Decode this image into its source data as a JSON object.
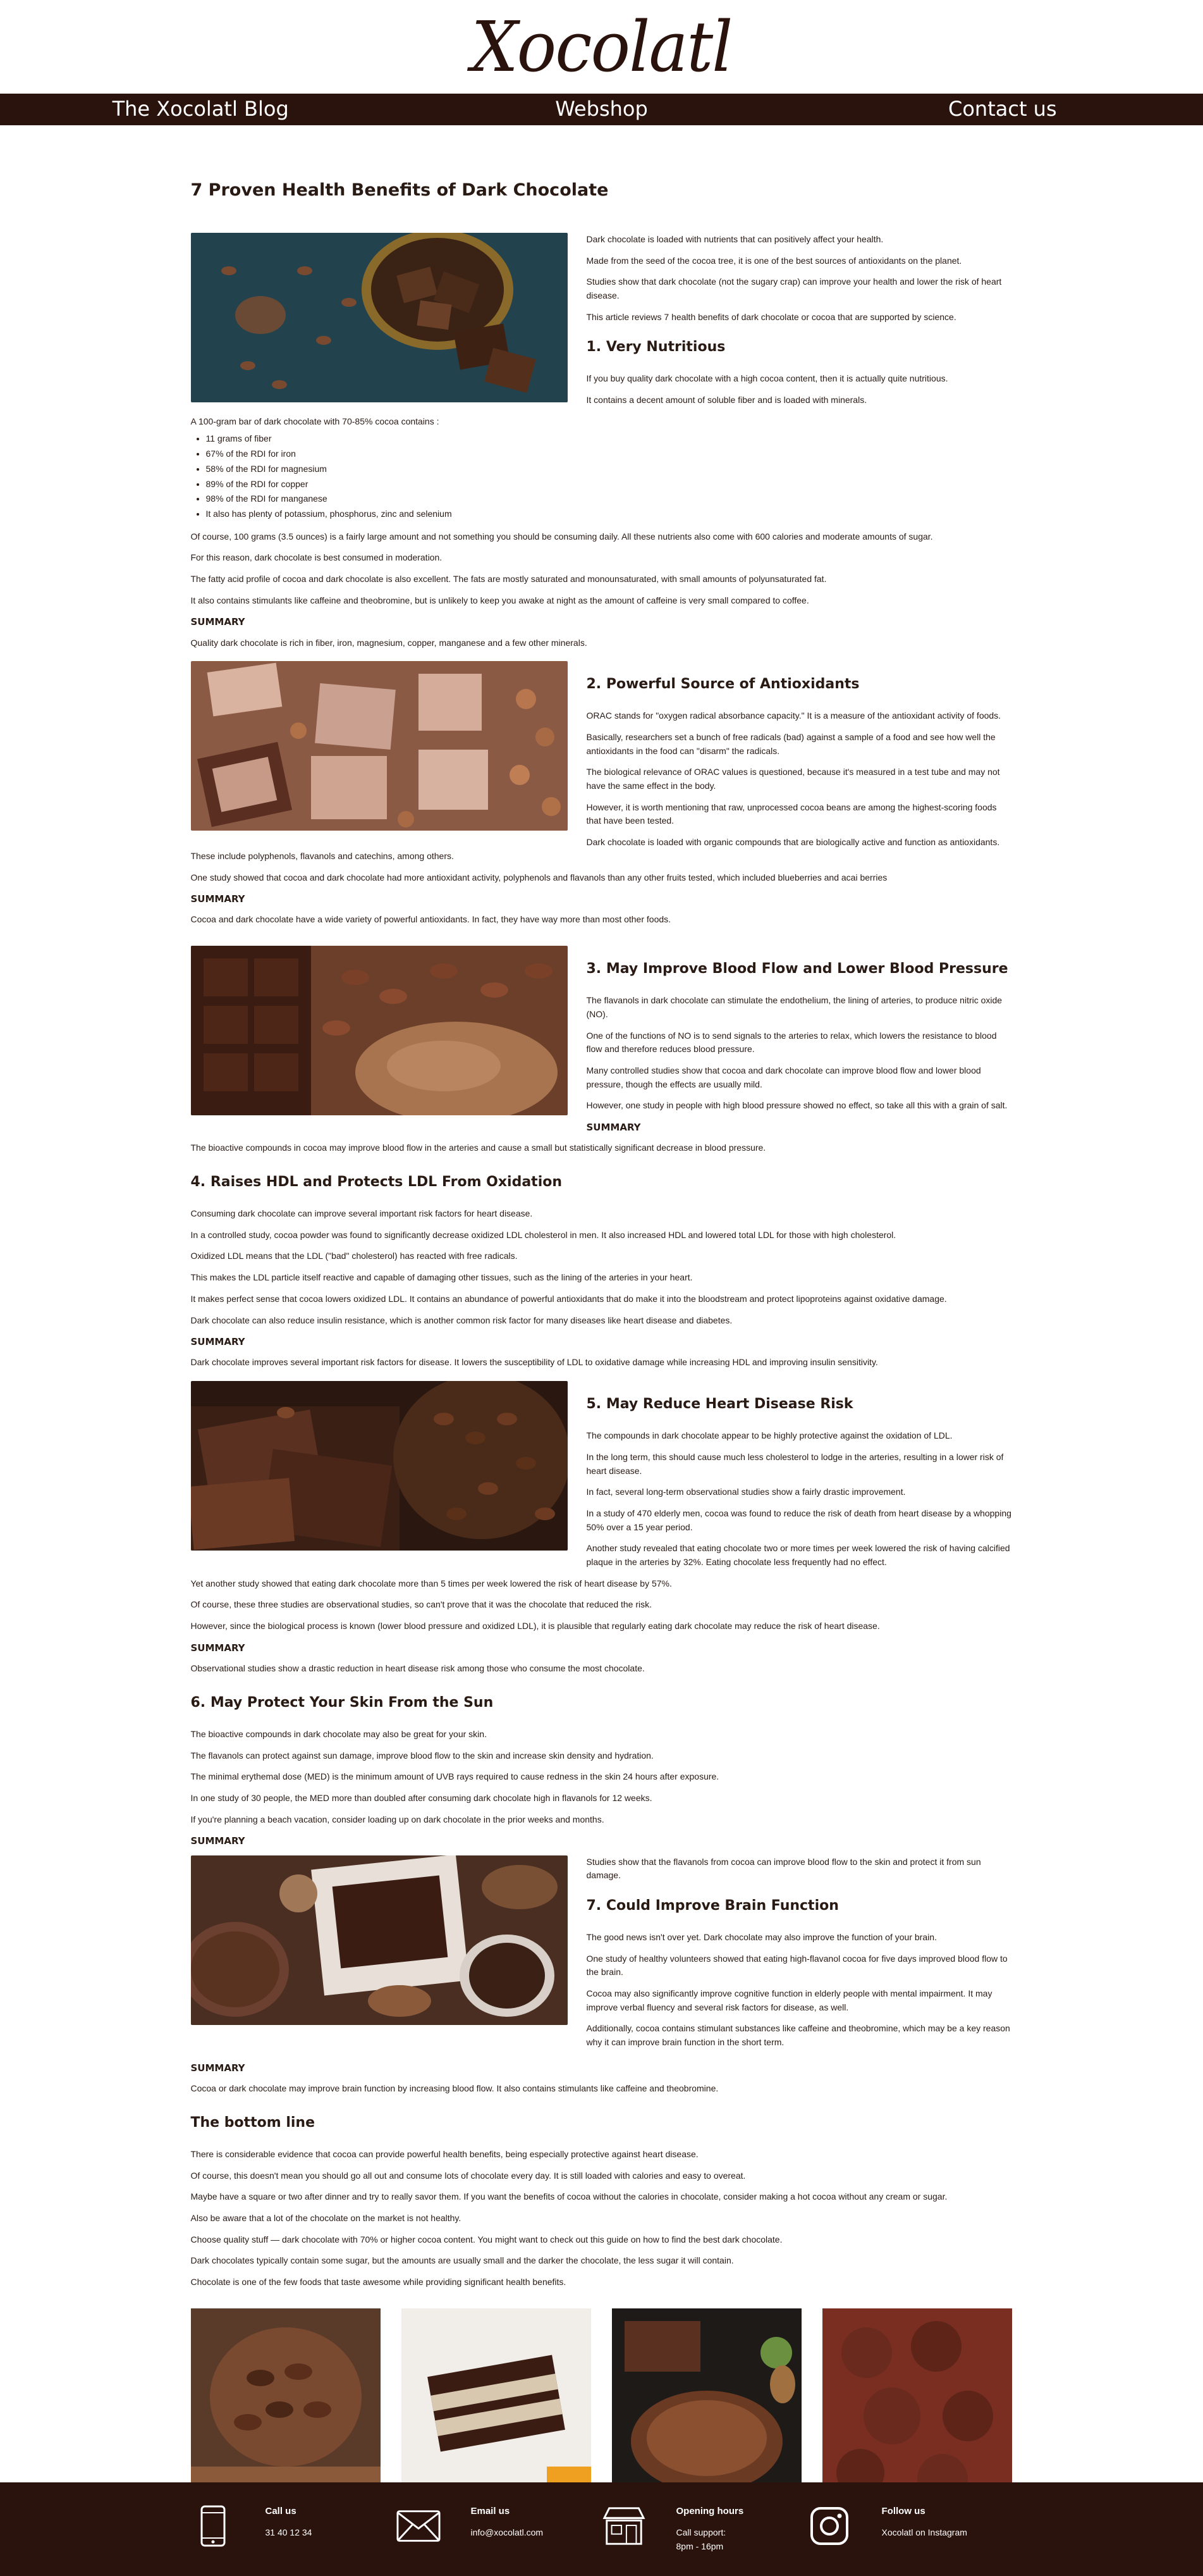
{
  "logo": "Xocolatl",
  "nav": [
    "The Xocolatl Blog",
    "Webshop",
    "Contact us"
  ],
  "title": "7 Proven Health Benefits of Dark Chocolate",
  "intro": [
    "Dark chocolate is loaded with nutrients that can positively affect your health.",
    "Made from the seed of the cocoa tree, it is one of the best sources of antioxidants on the planet.",
    "Studies show that dark chocolate (not the sugary crap) can improve your health and lower the risk of heart disease.",
    "This article reviews 7 health benefits of dark chocolate or cocoa that are supported by science."
  ],
  "s1": {
    "heading": "1. Very Nutritious",
    "p": [
      "If you buy quality dark chocolate with a high cocoa content, then it is actually quite nutritious.",
      "It contains a decent amount of soluble fiber and is loaded with minerals."
    ],
    "list_intro": "A 100-gram bar of dark chocolate with 70-85% cocoa contains :",
    "list": [
      "11 grams of fiber",
      "67% of the RDI for iron",
      "58% of the RDI for magnesium",
      "89% of the RDI for copper",
      "98% of the RDI for manganese",
      "It also has plenty of potassium, phosphorus, zinc and selenium"
    ],
    "p2": [
      "Of course, 100 grams (3.5 ounces) is a fairly large amount and not something you should be consuming daily. All these nutrients also come with 600 calories and moderate amounts of sugar.",
      "For this reason, dark chocolate is best consumed in moderation.",
      "The fatty acid profile of cocoa and dark chocolate is also excellent. The fats are mostly saturated and monounsaturated, with small amounts of polyunsaturated fat.",
      "It also contains stimulants like caffeine and theobromine, but is unlikely to keep you awake at night as the amount of caffeine is very small compared to coffee."
    ],
    "summary_label": "SUMMARY",
    "summary": "Quality dark chocolate is rich in fiber, iron, magnesium, copper, manganese and a few other minerals."
  },
  "s2": {
    "heading": "2. Powerful Source of Antioxidants",
    "p": [
      "ORAC stands for \"oxygen radical absorbance capacity.\" It is a measure of the antioxidant activity of foods.",
      "Basically, researchers set a bunch of free radicals (bad) against a sample of a food and see how well the antioxidants in the food can \"disarm\" the radicals.",
      "The biological relevance of ORAC values is questioned, because it's measured in a test tube and may not have the same effect in the body.",
      "However, it is worth mentioning that raw, unprocessed cocoa beans are among the highest-scoring foods that have been tested.",
      "Dark chocolate is loaded with organic compounds that are biologically active and function as antioxidants. These include polyphenols, flavanols and catechins, among others.",
      "One study showed that cocoa and dark chocolate had more antioxidant activity, polyphenols and flavanols than any other fruits tested, which included blueberries and acai berries"
    ],
    "summary_label": "SUMMARY",
    "summary": "Cocoa and dark chocolate have a wide variety of powerful antioxidants. In fact, they have way more than most other foods."
  },
  "s3": {
    "heading": "3. May Improve Blood Flow and Lower Blood Pressure",
    "p": [
      "The flavanols in dark chocolate can stimulate the endothelium, the lining of arteries, to produce nitric oxide (NO).",
      "One of the functions of NO is to send signals to the arteries to relax, which lowers the resistance to blood flow and therefore reduces blood pressure.",
      "Many controlled studies show that cocoa and dark chocolate can improve blood flow and lower blood pressure, though the effects are usually mild.",
      "However, one study in people with high blood pressure showed no effect, so take all this with a grain of salt."
    ],
    "summary_label": "SUMMARY",
    "summary": "The bioactive compounds in cocoa may improve blood flow in the arteries and cause a small but statistically significant decrease in blood pressure."
  },
  "s4": {
    "heading": "4. Raises HDL and Protects LDL From Oxidation",
    "p": [
      "Consuming dark chocolate can improve several important risk factors for heart disease.",
      "In a controlled study, cocoa powder was found to significantly decrease oxidized LDL cholesterol in men. It also increased HDL and lowered total LDL for those with high cholesterol.",
      "Oxidized LDL means that the LDL (\"bad\" cholesterol) has reacted with free radicals.",
      "This makes the LDL particle itself reactive and capable of damaging other tissues, such as the lining of the arteries in your heart.",
      "It makes perfect sense that cocoa lowers oxidized LDL. It contains an abundance of powerful antioxidants that do make it into the bloodstream and protect lipoproteins against oxidative damage.",
      "Dark chocolate can also reduce insulin resistance, which is another common risk factor for many diseases like heart disease and diabetes."
    ],
    "summary_label": "SUMMARY",
    "summary": "Dark chocolate improves several important risk factors for disease. It lowers the susceptibility of LDL to oxidative damage while increasing HDL and improving insulin sensitivity."
  },
  "s5": {
    "heading": "5. May Reduce Heart Disease Risk",
    "p": [
      "The compounds in dark chocolate appear to be highly protective against the oxidation of LDL.",
      "In the long term, this should cause much less cholesterol to lodge in the arteries, resulting in a lower risk of heart disease.",
      "In fact, several long-term observational studies show a fairly drastic improvement.",
      "In a study of 470 elderly men, cocoa was found to reduce the risk of death from heart disease by a whopping 50% over a 15 year period.",
      "Another study revealed that eating chocolate two or more times per week lowered the risk of having calcified plaque in the arteries by 32%. Eating chocolate less frequently had no effect.",
      "Yet another study showed that eating dark chocolate more than 5 times per week lowered the risk of heart disease by 57%.",
      "Of course, these three studies are observational studies, so can't prove that it was the chocolate that reduced the risk.",
      "However, since the biological process is known (lower blood pressure and oxidized LDL), it is plausible that regularly eating dark chocolate may reduce the risk of heart disease."
    ],
    "summary_label": "SUMMARY",
    "summary": "Observational studies show a drastic reduction in heart disease risk among those who consume the most chocolate."
  },
  "s6": {
    "heading": "6. May Protect Your Skin From the Sun",
    "p": [
      "The bioactive compounds in dark chocolate may also be great for your skin.",
      "The flavanols can protect against sun damage, improve blood flow to the skin and increase skin density and hydration.",
      "The minimal erythemal dose (MED) is the minimum amount of UVB rays required to cause redness in the skin 24 hours after exposure.",
      "In one study of 30 people, the MED more than doubled after consuming dark chocolate high in flavanols for 12 weeks.",
      "If you're planning a beach vacation, consider loading up on dark chocolate in the prior weeks and months."
    ],
    "summary_label": "SUMMARY",
    "summary": "Studies show that the flavanols from cocoa can improve blood flow to the skin and protect it from sun damage."
  },
  "s7": {
    "heading": "7. Could Improve Brain Function",
    "p": [
      "The good news isn't over yet. Dark chocolate may also improve the function of your brain.",
      "One study of healthy volunteers showed that eating high-flavanol cocoa for five days improved blood flow to the brain.",
      "Cocoa may also significantly improve cognitive function in elderly people with mental impairment. It may improve verbal fluency and several risk factors for disease, as well.",
      "Additionally, cocoa contains stimulant substances like caffeine and theobromine, which may be a key reason why it can improve brain function in the short term."
    ],
    "summary_label": "SUMMARY",
    "summary": "Cocoa or dark chocolate may improve brain function by increasing blood flow. It also contains stimulants like caffeine and theobromine."
  },
  "bottom": {
    "heading": "The bottom line",
    "p": [
      "There is considerable evidence that cocoa can provide powerful health benefits, being especially protective against heart disease.",
      "Of course, this doesn't mean you should go all out and consume lots of chocolate every day. It is still loaded with calories and easy to overeat.",
      "Maybe have a square or two after dinner and try to really savor them. If you want the benefits of cocoa without the calories in chocolate, consider making a hot cocoa without any cream or sugar.",
      "Also be aware that a lot of the chocolate on the market is not healthy.",
      "Choose quality stuff — dark chocolate with 70% or higher cocoa content. You might want to check out this guide on how to find the best dark chocolate.",
      "Dark chocolates typically contain some sugar, but the amounts are usually small and the darker the chocolate, the less sugar it will contain.",
      "Chocolate is one of the few foods that taste awesome while providing significant health benefits."
    ]
  },
  "footer": {
    "call": {
      "title": "Call us",
      "text": "31 40 12 34"
    },
    "email": {
      "title": "Email us",
      "text": "info@xocolatl.com"
    },
    "hours": {
      "title": "Opening hours",
      "text1": "Call support:",
      "text2": "8pm - 16pm"
    },
    "follow": {
      "title": "Follow us",
      "text": "Xocolatl on Instagram"
    }
  },
  "colors": {
    "brand": "#2b130d",
    "text": "#2a1a14"
  }
}
